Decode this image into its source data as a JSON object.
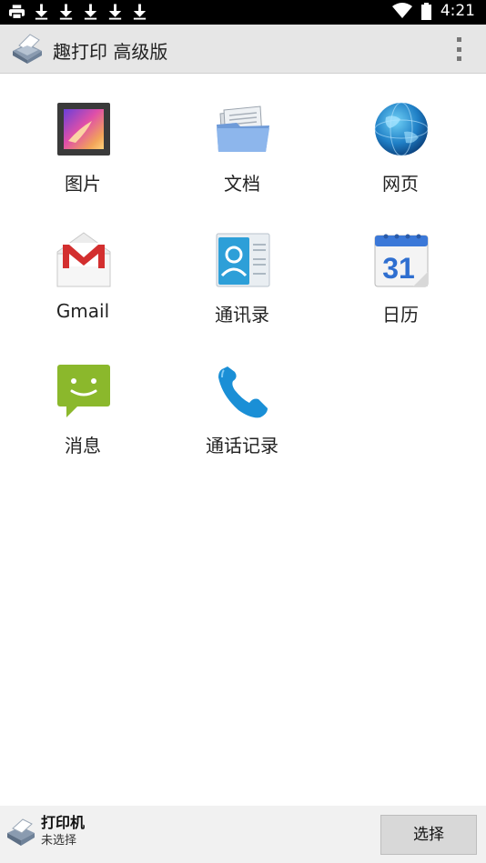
{
  "status_bar": {
    "left_icons": [
      "printer-icon",
      "download-icon",
      "download-icon",
      "download-icon",
      "download-icon",
      "download-icon"
    ],
    "right_icons": [
      "wifi-icon",
      "battery-icon"
    ],
    "time": "4:21"
  },
  "action_bar": {
    "title": "趣打印 高级版",
    "app_icon": "printer-app-icon",
    "overflow_icon": "more-vert-icon"
  },
  "sources": [
    {
      "label": "图片",
      "icon": "gallery-icon"
    },
    {
      "label": "文档",
      "icon": "folder-documents-icon"
    },
    {
      "label": "网页",
      "icon": "globe-icon"
    },
    {
      "label": "Gmail",
      "icon": "gmail-icon"
    },
    {
      "label": "通讯录",
      "icon": "contacts-icon"
    },
    {
      "label": "日历",
      "icon": "calendar-icon",
      "calendar_day": "31"
    },
    {
      "label": "消息",
      "icon": "message-icon"
    },
    {
      "label": "通话记录",
      "icon": "phone-icon"
    }
  ],
  "bottom_bar": {
    "printer_label": "打印机",
    "printer_status": "未选择",
    "select_button": "选择",
    "printer_icon": "printer-icon"
  }
}
